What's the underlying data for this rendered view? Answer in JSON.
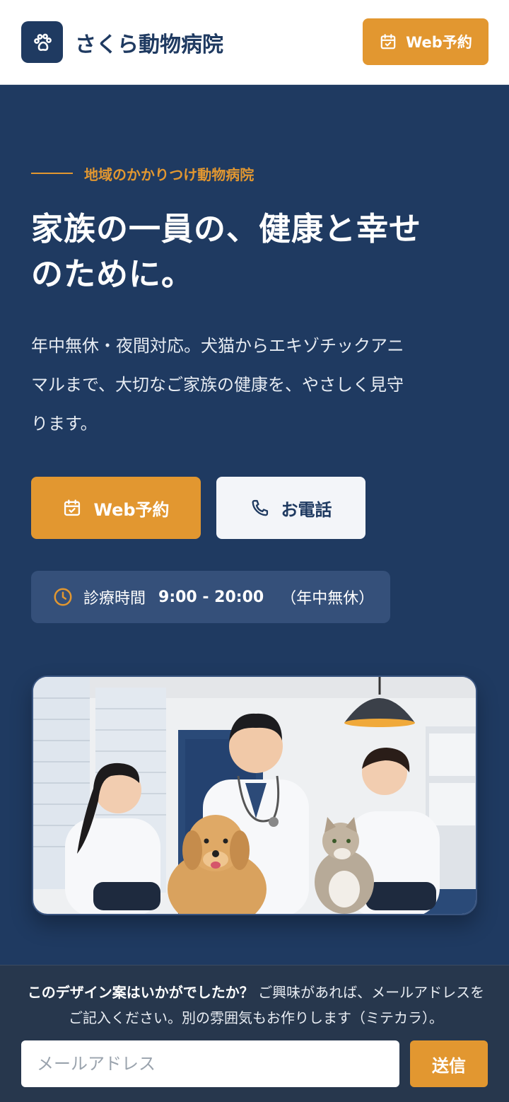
{
  "header": {
    "brand": "さくら動物病院",
    "logo_icon": "paw-icon",
    "reserve_label": "Web予約"
  },
  "hero": {
    "eyebrow": "地域のかかりつけ動物病院",
    "title_line1": "家族の一員の、健康と幸せ",
    "title_line2": "のために。",
    "description_line1": "年中無休・夜間対応。犬猫からエキゾチックアニ",
    "description_line2": "マルまで、大切なご家族の健康を、やさしく見守",
    "description_line3": "ります。",
    "primary_button": "Web予約",
    "secondary_button": "お電話"
  },
  "hours": {
    "label": "診療時間",
    "time": "9:00 - 20:00",
    "note": "（年中無休）"
  },
  "feedback": {
    "question": "このデザイン案はいかがでしたか？",
    "message": "ご興味があれば、メールアドレスをご記入ください。別の雰囲気もお作りします（ミテカラ）。",
    "email_placeholder": "メールアドレス",
    "send_label": "送信"
  },
  "colors": {
    "navy": "#1f3a61",
    "accent": "#e29730",
    "feedback_bg": "#27374d"
  }
}
